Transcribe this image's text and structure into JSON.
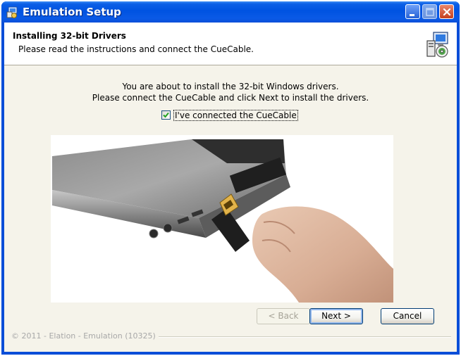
{
  "window": {
    "title": "Emulation Setup"
  },
  "header": {
    "title": "Installing 32-bit Drivers",
    "subtitle": "Please read the instructions and connect the CueCable."
  },
  "body": {
    "line1": "You are about to install the 32-bit Windows drivers.",
    "line2": "Please connect the CueCable and click Next to install the drivers.",
    "checkbox": {
      "label": "I've connected the CueCable",
      "checked": true
    }
  },
  "footer": {
    "copyright": "© 2011 - Elation - Emulation (10325)"
  },
  "buttons": {
    "back": "< Back",
    "next": "Next >",
    "cancel": "Cancel"
  },
  "colors": {
    "titlebar": "#0053e1",
    "panel": "#ece9d8",
    "button_border": "#003c74"
  },
  "icons": {
    "app": "installer-icon",
    "header": "installer-computer-icon",
    "minimize": "minimize-icon",
    "maximize": "maximize-icon",
    "close": "close-icon",
    "check": "checkmark-icon"
  }
}
